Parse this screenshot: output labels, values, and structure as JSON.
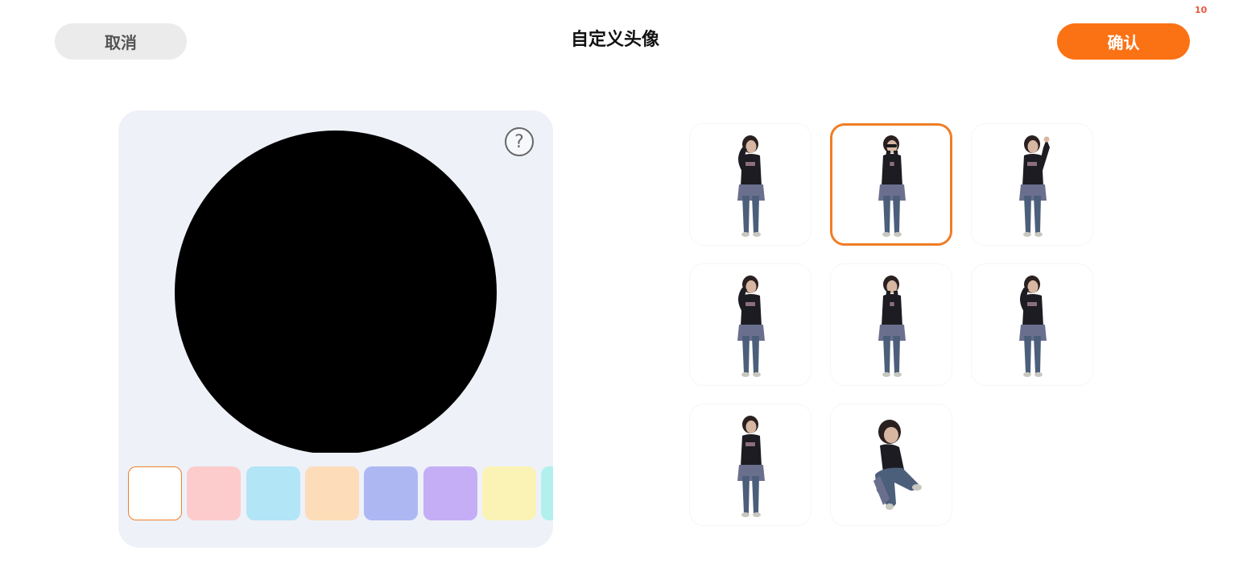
{
  "header": {
    "notification_count": "10",
    "cancel_label": "取消",
    "title": "自定义头像",
    "confirm_label": "确认"
  },
  "editor": {
    "preview_background": "#000000",
    "help_icon": "question-circle-icon",
    "background_colors": [
      {
        "color": "#ffffff",
        "selected": true
      },
      {
        "color": "#fccccd",
        "selected": false
      },
      {
        "color": "#b2e5f6",
        "selected": false
      },
      {
        "color": "#fddcb9",
        "selected": false
      },
      {
        "color": "#adb8f3",
        "selected": false
      },
      {
        "color": "#c5aef5",
        "selected": false
      },
      {
        "color": "#faf3b5",
        "selected": false
      },
      {
        "color": "#b2f0ef",
        "selected": false
      }
    ]
  },
  "poses": [
    {
      "name": "pose-hand-on-head",
      "selected": false
    },
    {
      "name": "pose-sunglasses",
      "selected": true
    },
    {
      "name": "pose-arm-raised",
      "selected": false
    },
    {
      "name": "pose-salute",
      "selected": false
    },
    {
      "name": "pose-hands-on-face",
      "selected": false
    },
    {
      "name": "pose-hand-on-hair",
      "selected": false
    },
    {
      "name": "pose-arms-crossed",
      "selected": false
    },
    {
      "name": "pose-sitting",
      "selected": false
    }
  ],
  "colors": {
    "accent": "#fb7214",
    "selected_border": "#f07d26",
    "editor_background": "#eef1f8",
    "cancel_background": "#ebebeb"
  }
}
